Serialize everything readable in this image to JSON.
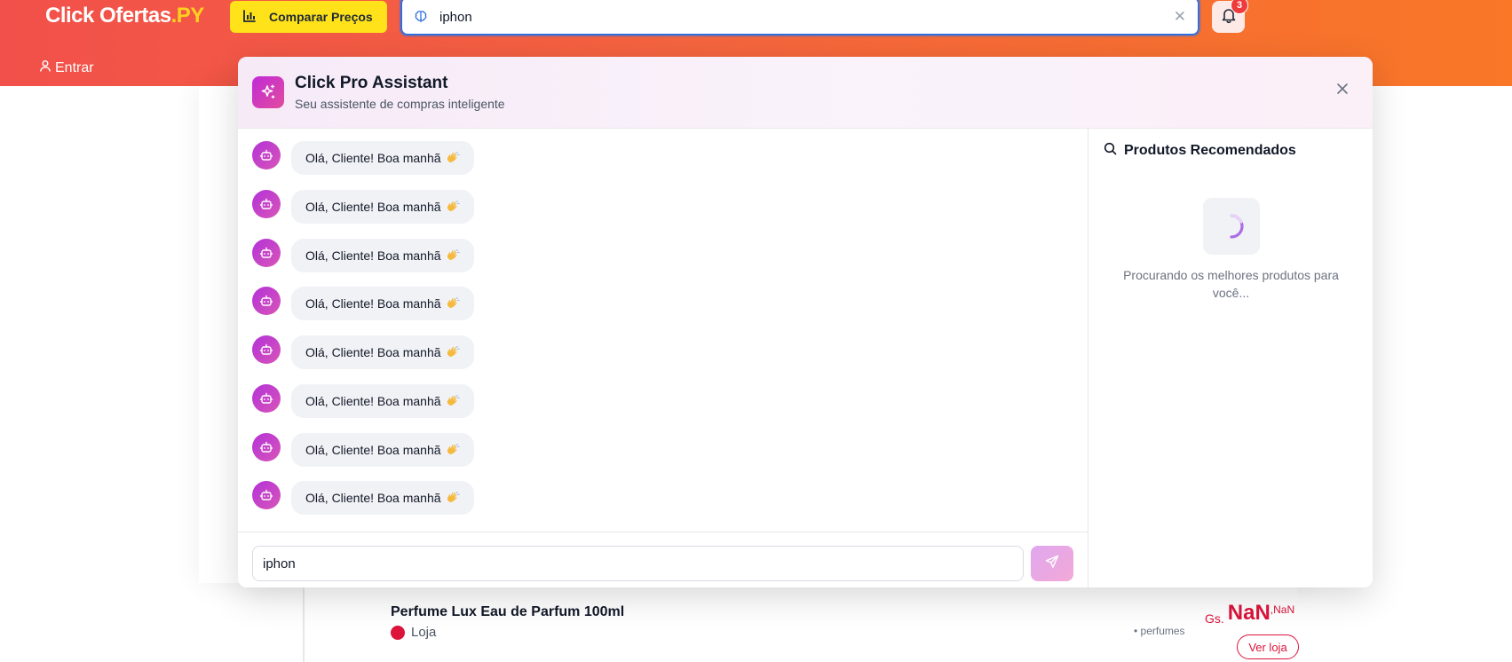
{
  "header": {
    "logo_main": "Click Ofertas",
    "logo_suffix": ".PY",
    "compare_label": "Comparar Preços",
    "search_value": "iphon",
    "notification_count": "3",
    "login_label": "Entrar"
  },
  "assistant": {
    "title": "Click Pro Assistant",
    "subtitle": "Seu assistente de compras inteligente",
    "messages": [
      {
        "text": "Olá, Cliente! Boa manhã"
      },
      {
        "text": "Olá, Cliente! Boa manhã"
      },
      {
        "text": "Olá, Cliente! Boa manhã"
      },
      {
        "text": "Olá, Cliente! Boa manhã"
      },
      {
        "text": "Olá, Cliente! Boa manhã"
      },
      {
        "text": "Olá, Cliente! Boa manhã"
      },
      {
        "text": "Olá, Cliente! Boa manhã"
      },
      {
        "text": "Olá, Cliente! Boa manhã"
      }
    ],
    "input_value": "iphon",
    "recommended_title": "Produtos Recomendados",
    "loading_text": "Procurando os melhores produtos para você..."
  },
  "product": {
    "name": "Perfume Lux Eau de Parfum 100ml",
    "store": "Loja",
    "category": "• perfumes",
    "currency": "Gs.",
    "price_int": "NaN",
    "price_dec": ",NaN",
    "store_button": "Ver loja"
  },
  "colors": {
    "header_gradient_start": "#f2504a",
    "header_gradient_end": "#f97727",
    "brand_yellow": "#ffe21a",
    "assistant_accent": "#c02ad8",
    "price_red": "#dc143c"
  }
}
